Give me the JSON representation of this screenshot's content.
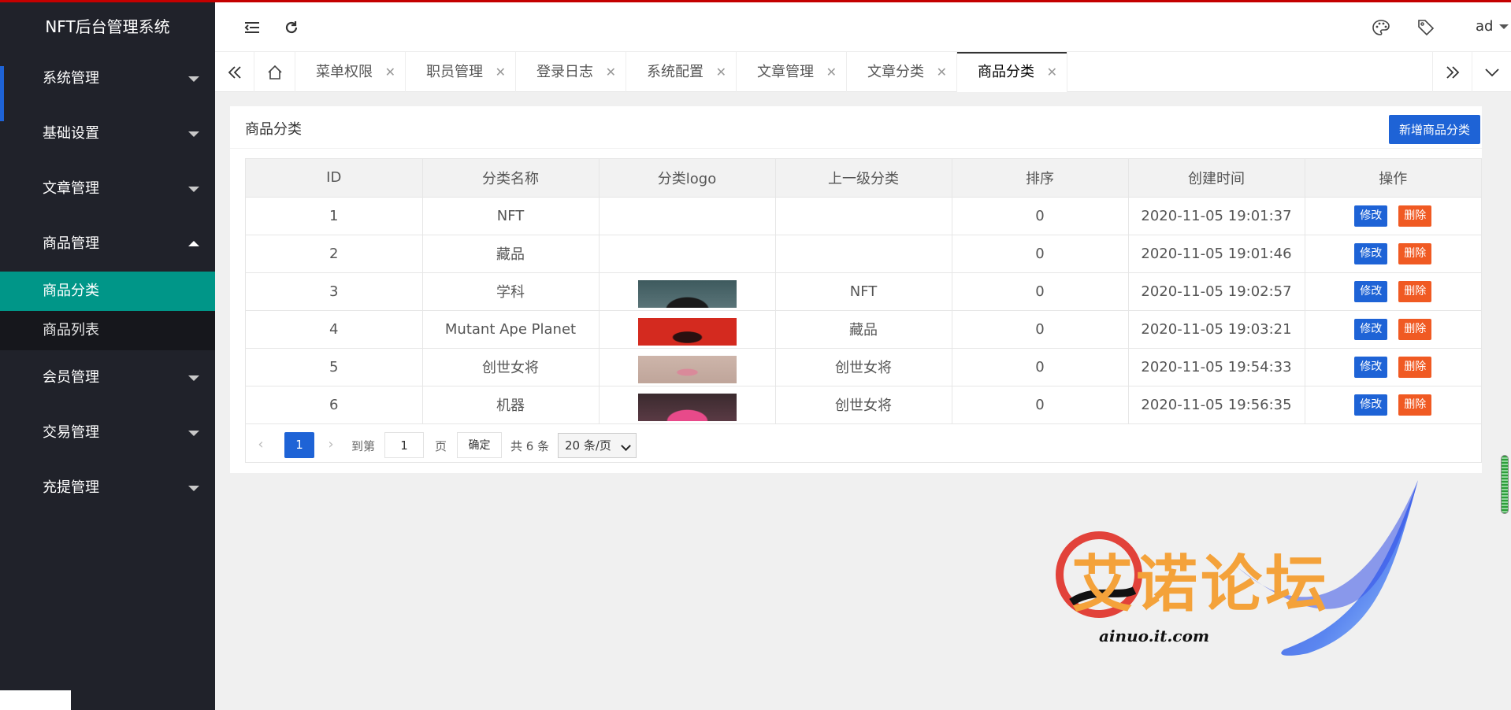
{
  "app": {
    "title": "NFT后台管理系统"
  },
  "sidebar": {
    "items": [
      {
        "label": "系统管理"
      },
      {
        "label": "基础设置"
      },
      {
        "label": "文章管理"
      },
      {
        "label": "商品管理"
      },
      {
        "label": "会员管理"
      },
      {
        "label": "交易管理"
      },
      {
        "label": "充提管理"
      }
    ],
    "sub_items": [
      {
        "label": "商品分类"
      },
      {
        "label": "商品列表"
      }
    ]
  },
  "header": {
    "user": "ad"
  },
  "tabs": [
    {
      "label": "菜单权限"
    },
    {
      "label": "职员管理"
    },
    {
      "label": "登录日志"
    },
    {
      "label": "系统配置"
    },
    {
      "label": "文章管理"
    },
    {
      "label": "文章分类"
    },
    {
      "label": "商品分类"
    }
  ],
  "page": {
    "title": "商品分类",
    "add_button": "新增商品分类"
  },
  "table": {
    "headers": [
      "ID",
      "分类名称",
      "分类logo",
      "上一级分类",
      "排序",
      "创建时间",
      "操作"
    ],
    "edit_label": "修改",
    "delete_label": "删除",
    "rows": [
      {
        "id": "1",
        "name": "NFT",
        "parent": "",
        "sort": "0",
        "created": "2020-11-05 19:01:37"
      },
      {
        "id": "2",
        "name": "藏品",
        "parent": "",
        "sort": "0",
        "created": "2020-11-05 19:01:46"
      },
      {
        "id": "3",
        "name": "学科",
        "parent": "NFT",
        "sort": "0",
        "created": "2020-11-05 19:02:57"
      },
      {
        "id": "4",
        "name": "Mutant Ape Planet",
        "parent": "藏品",
        "sort": "0",
        "created": "2020-11-05 19:03:21"
      },
      {
        "id": "5",
        "name": "创世女将",
        "parent": "创世女将",
        "sort": "0",
        "created": "2020-11-05 19:54:33"
      },
      {
        "id": "6",
        "name": "机器",
        "parent": "创世女将",
        "sort": "0",
        "created": "2020-11-05 19:56:35"
      }
    ]
  },
  "pagination": {
    "current": "1",
    "goto_label": "到第",
    "goto_value": "1",
    "page_label": "页",
    "confirm": "确定",
    "total": "共 6 条",
    "page_size": "20 条/页"
  },
  "watermark": {
    "text": "艾诺论坛",
    "url": "ainuo.it.com"
  },
  "colors": {
    "primary": "#1e63d6",
    "danger": "#f05a23",
    "sidebar": "#20222a",
    "selected": "#009688"
  }
}
